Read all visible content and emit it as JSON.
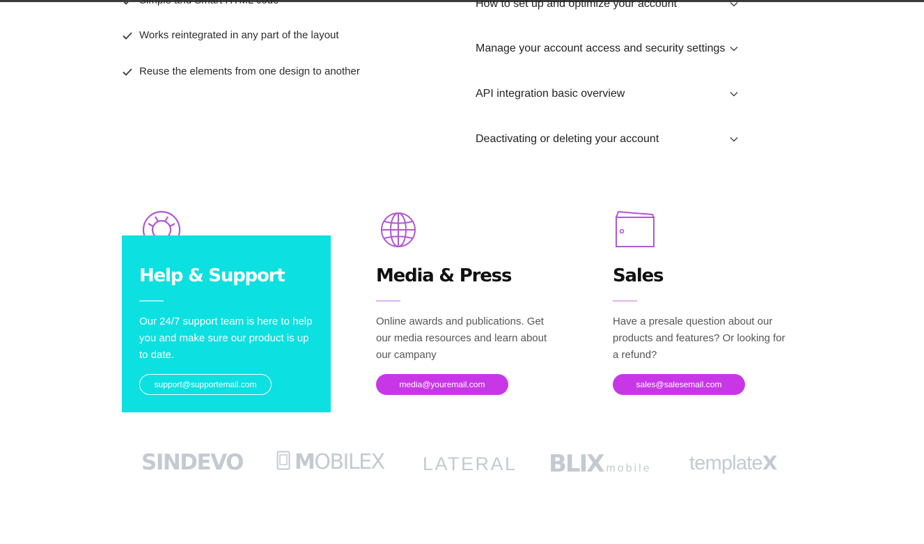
{
  "features": {
    "items": [
      "Simple and Smart HTML code",
      "Works reintegrated in any part of the layout",
      "Reuse the elements from one design to another"
    ]
  },
  "faq": {
    "items": [
      "How to set up and optimize your account",
      "Manage your account access and security settings",
      "API integration basic overview",
      "Deactivating or deleting your account"
    ]
  },
  "cards": {
    "help": {
      "title": "Help & Support",
      "text": "Our 24/7 support team is here to help you and make sure our product is up to date.",
      "button": "support@supportemail.com",
      "icon": "lifebuoy-icon"
    },
    "media": {
      "title": "Media & Press",
      "text": "Online awards and publications. Get our media resources and learn about our campany",
      "button": "media@youremail.com",
      "icon": "globe-icon"
    },
    "sales": {
      "title": "Sales",
      "text": "Have a presale question about our products and features? Or looking for a refund?",
      "button": "sales@salesemail.com",
      "icon": "wallet-icon"
    }
  },
  "logos": {
    "sindevo": "SINDEVO",
    "mobilex_m": "M",
    "mobilex_rest": "OBILEX",
    "lateral": "LATERAL",
    "blix": "BLIX",
    "blix_sub": "mobile",
    "template_prefix": "template",
    "template_x": "X"
  },
  "colors": {
    "accent_purple": "#c837e6",
    "help_bg": "#0ce0e0",
    "icon_purple": "#b057d6",
    "logo_gray": "#c4cad1"
  }
}
